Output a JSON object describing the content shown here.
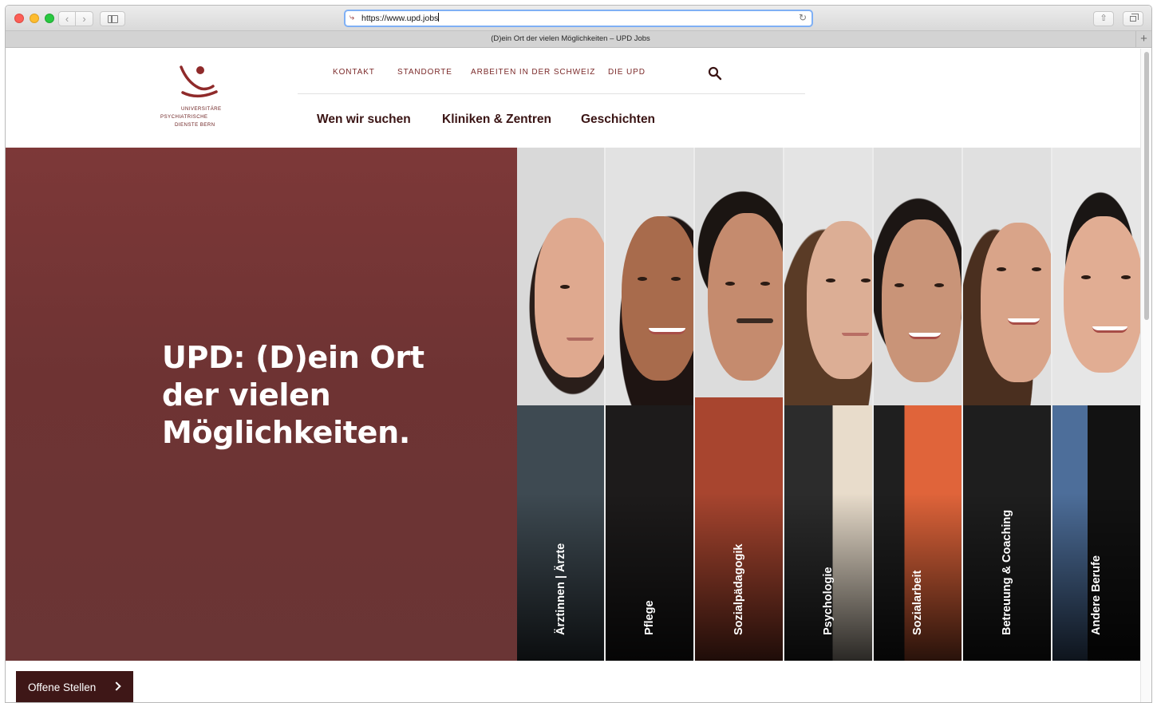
{
  "browser": {
    "url": "https://www.upd.jobs",
    "tab_title": "(D)ein Ort der vielen Möglichkeiten – UPD Jobs",
    "new_tab_label": "+"
  },
  "logo": {
    "line1": "Universitäre",
    "line2": "Psychiatrische",
    "line3": "Dienste Bern",
    "brand_color": "#8f2a2a"
  },
  "utility_nav": [
    "KONTAKT",
    "STANDORTE",
    "ARBEITEN IN DER SCHWEIZ",
    "DIE UPD"
  ],
  "main_nav": [
    "Wen wir suchen",
    "Kliniken & Zentren",
    "Geschichten"
  ],
  "hero": {
    "title_lines": [
      "UPD: (D)ein Ort",
      "der vielen",
      "Möglichkeiten."
    ],
    "panel_color": "#723535"
  },
  "professions": [
    {
      "label": "Ärztinnen | Ärzte",
      "icon": "portrait-woman-dark-hair"
    },
    {
      "label": "Pflege",
      "icon": "portrait-woman-long-dark-hair"
    },
    {
      "label": "Sozialpädagogik",
      "icon": "portrait-man-curly-hair"
    },
    {
      "label": "Psychologie",
      "icon": "portrait-woman-wavy-hair"
    },
    {
      "label": "Sozialarbeit",
      "icon": "portrait-woman-dark-hair-orange-top"
    },
    {
      "label": "Betreuung & Coaching",
      "icon": "portrait-woman-earrings"
    },
    {
      "label": "Andere Berufe",
      "icon": "portrait-woman-blue-blazer"
    }
  ],
  "cta": {
    "label": "Offene Stellen"
  }
}
